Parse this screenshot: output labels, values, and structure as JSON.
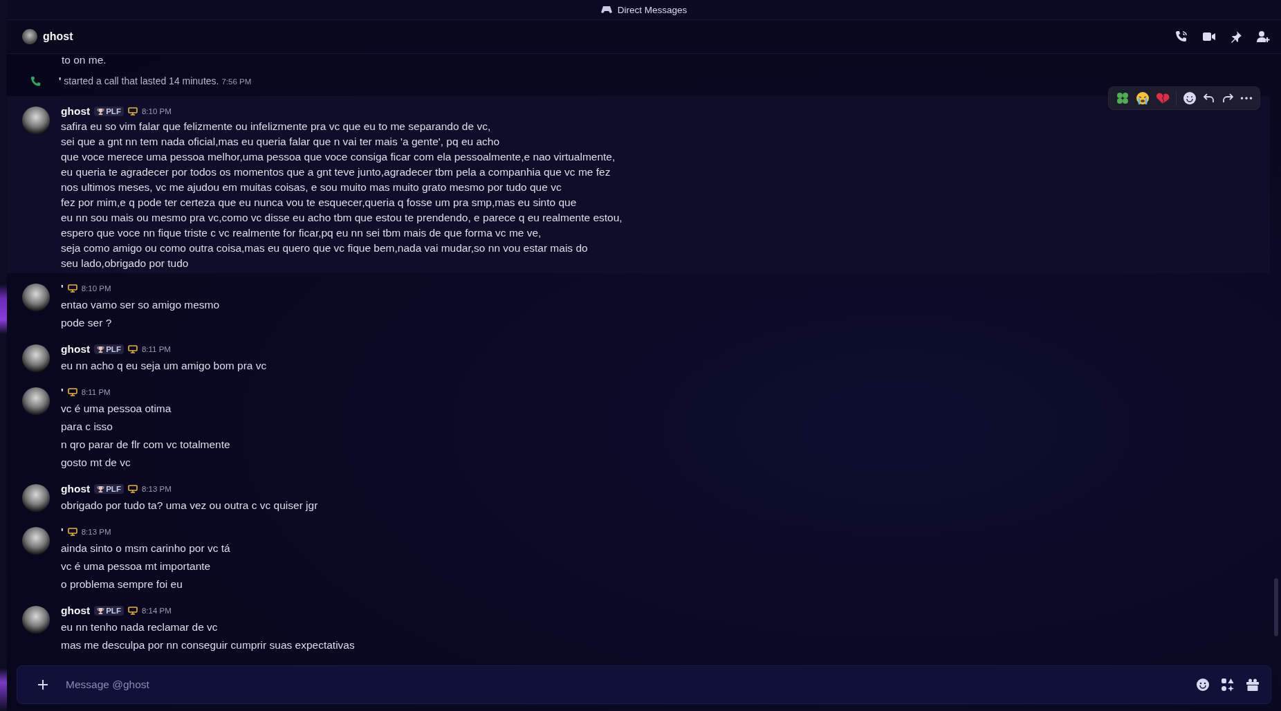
{
  "titlebar": {
    "title": "Direct Messages"
  },
  "header": {
    "name": "ghost"
  },
  "messages": [
    {
      "kind": "continuation",
      "lines": [
        "to on me."
      ]
    },
    {
      "kind": "call",
      "author": "'",
      "text": "started a call that lasted 14 minutes.",
      "time": "7:56 PM"
    },
    {
      "kind": "message",
      "author": "ghost",
      "badge": "PLF",
      "time": "8:10 PM",
      "hovered": true,
      "wrapped": true,
      "lines": [
        "safira eu so vim falar que felizmente ou infelizmente pra vc que eu to me separando de vc,",
        "sei que a gnt nn tem nada oficial,mas eu queria falar que n vai ter mais 'a gente', pq eu acho",
        "que voce merece uma pessoa melhor,uma pessoa que voce consiga ficar com ela pessoalmente,e nao virtualmente,",
        "eu queria te agradecer por todos os momentos que a gnt teve junto,agradecer tbm pela a companhia que vc me fez",
        "nos ultimos meses, vc me ajudou em muitas coisas, e sou muito mas muito grato mesmo por tudo que vc",
        "fez por mim,e q pode ter certeza que eu nunca vou te esquecer,queria q fosse um pra smp,mas eu sinto que",
        "eu nn sou mais ou mesmo pra vc,como vc disse eu acho tbm que estou te prendendo, e parece q eu realmente estou,",
        "espero que voce nn fique triste c vc realmente for ficar,pq eu nn sei tbm mais de que forma vc me ve,",
        "seja como amigo ou como outra coisa,mas eu quero que vc fique bem,nada vai mudar,so nn vou estar mais do",
        "seu lado,obrigado por tudo"
      ]
    },
    {
      "kind": "message",
      "author": "'",
      "time": "8:10 PM",
      "hovered": false,
      "wrapped": false,
      "lines": [
        "entao vamo ser so amigo mesmo",
        "pode ser ?"
      ]
    },
    {
      "kind": "message",
      "author": "ghost",
      "badge": "PLF",
      "time": "8:11 PM",
      "hovered": false,
      "wrapped": false,
      "lines": [
        "eu nn acho q eu seja um amigo bom pra vc"
      ]
    },
    {
      "kind": "message",
      "author": "'",
      "time": "8:11 PM",
      "hovered": false,
      "wrapped": false,
      "lines": [
        "vc é uma pessoa otima",
        "para c isso",
        "n qro parar de flr com vc totalmente",
        "gosto mt de vc"
      ]
    },
    {
      "kind": "message",
      "author": "ghost",
      "badge": "PLF",
      "time": "8:13 PM",
      "hovered": false,
      "wrapped": false,
      "lines": [
        "obrigado por tudo ta? uma vez ou outra c vc quiser jgr"
      ]
    },
    {
      "kind": "message",
      "author": "'",
      "time": "8:13 PM",
      "hovered": false,
      "wrapped": false,
      "lines": [
        "ainda sinto o msm carinho por vc tá",
        "vc é uma pessoa mt importante",
        "o problema sempre foi eu"
      ]
    },
    {
      "kind": "message",
      "author": "ghost",
      "badge": "PLF",
      "time": "8:14 PM",
      "hovered": false,
      "wrapped": false,
      "lines": [
        "eu nn tenho nada reclamar de vc",
        "mas me desculpa por nn conseguir cumprir suas expectativas"
      ]
    }
  ],
  "composer": {
    "placeholder": "Message @ghost"
  }
}
